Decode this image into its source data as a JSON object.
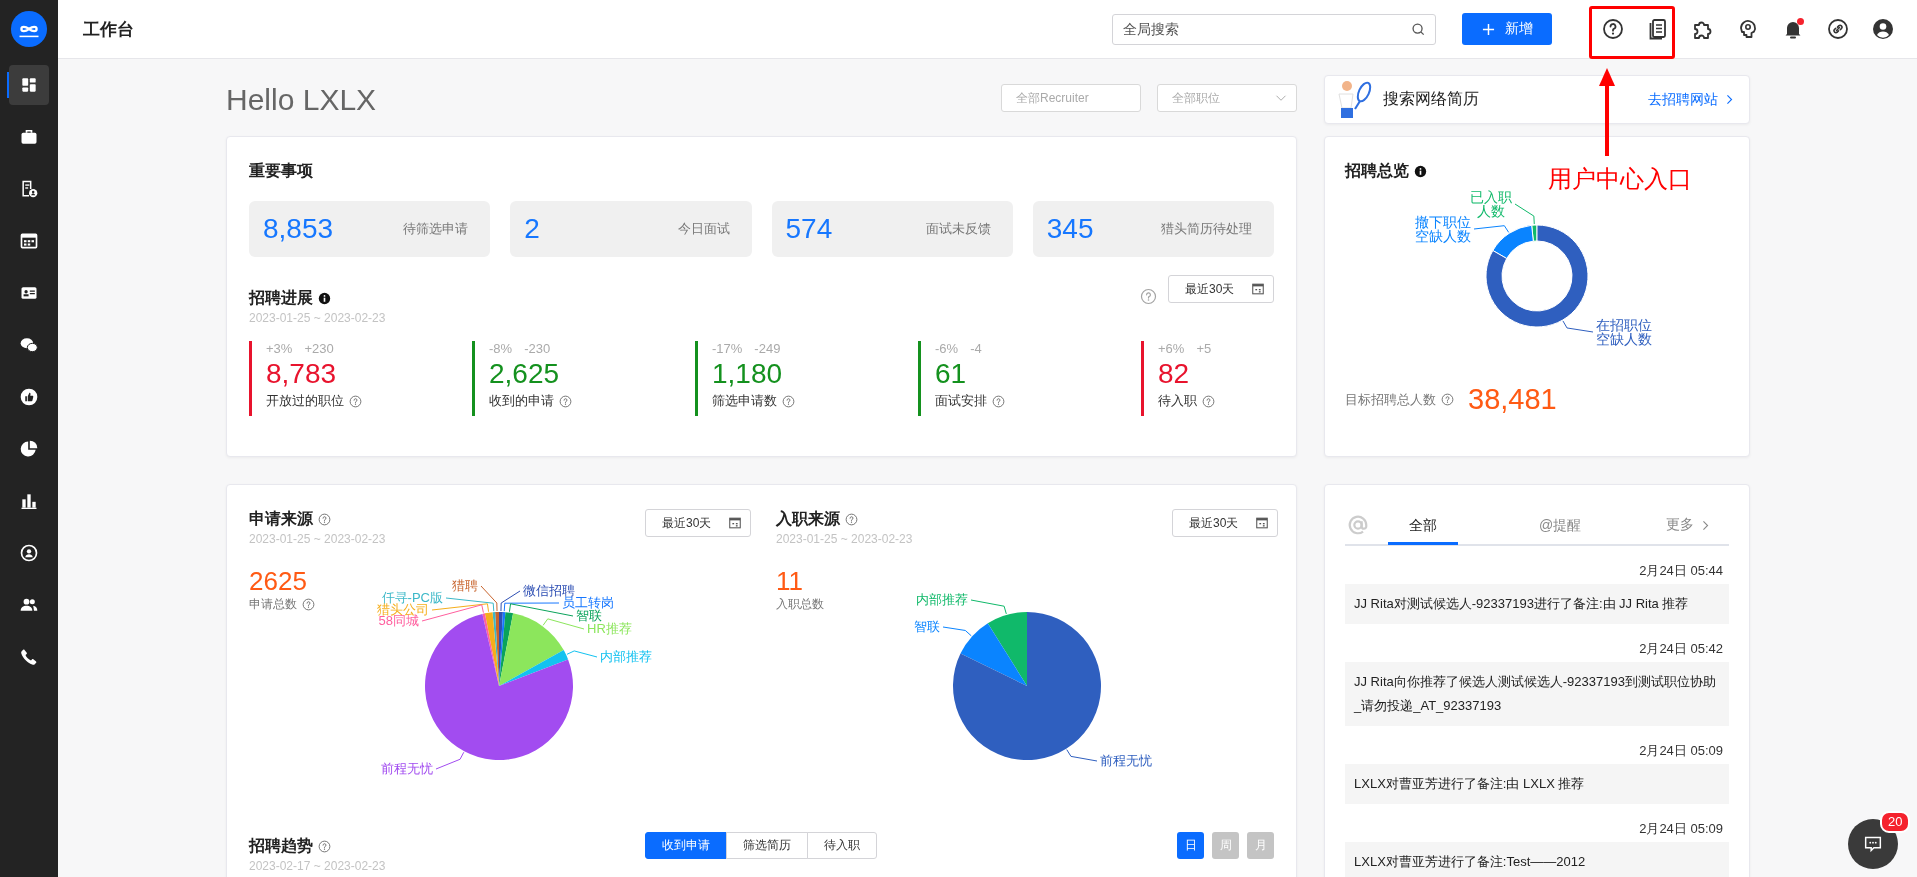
{
  "sidebar": {
    "items": [
      {
        "kind": "dashboard",
        "selected": true
      },
      {
        "kind": "briefcase",
        "selected": false
      },
      {
        "kind": "resume",
        "selected": false
      },
      {
        "kind": "calendar",
        "selected": false
      },
      {
        "kind": "idcard",
        "selected": false
      },
      {
        "kind": "chat",
        "selected": false
      },
      {
        "kind": "thumb",
        "selected": false
      },
      {
        "kind": "pie",
        "selected": false
      },
      {
        "kind": "bars",
        "selected": false
      },
      {
        "kind": "person",
        "selected": false
      },
      {
        "kind": "people",
        "selected": false
      },
      {
        "kind": "phone",
        "selected": false
      }
    ]
  },
  "header": {
    "title": "工作台",
    "search": {
      "placeholder": "全局搜索"
    },
    "new_button": "新增"
  },
  "toolbar": [
    {
      "kind": "help",
      "badge": false
    },
    {
      "kind": "docs",
      "badge": false
    },
    {
      "kind": "puzzle",
      "badge": false
    },
    {
      "kind": "head",
      "badge": false
    },
    {
      "kind": "bell",
      "badge": true
    },
    {
      "kind": "link",
      "badge": false
    },
    {
      "kind": "user",
      "badge": false
    }
  ],
  "greeting": "Hello LXLX",
  "filters": [
    {
      "kind": "input",
      "placeholder": "全部Recruiter"
    },
    {
      "kind": "select",
      "placeholder": "全部职位"
    }
  ],
  "banner": {
    "title": "搜索网络简历",
    "link": "去招聘网站"
  },
  "important": {
    "title": "重要事项",
    "tiles": [
      {
        "count": "8,853",
        "caption": "待筛选申请"
      },
      {
        "count": "2",
        "caption": "今日面试"
      },
      {
        "count": "574",
        "caption": "面试未反馈"
      },
      {
        "count": "345",
        "caption": "猎头简历待处理"
      }
    ]
  },
  "progress": {
    "title": "招聘进展",
    "date_range": "2023-01-25 ~ 2023-02-23",
    "period": "最近30天",
    "metrics": [
      {
        "pct": "+3%",
        "delta": "+230",
        "value": "8,783",
        "label": "开放过的职位",
        "color": "#e8132d"
      },
      {
        "pct": "-8%",
        "delta": "-230",
        "value": "2,625",
        "label": "收到的申请",
        "color": "#14911e"
      },
      {
        "pct": "-17%",
        "delta": "-249",
        "value": "1,180",
        "label": "筛选申请数",
        "color": "#14911e"
      },
      {
        "pct": "-6%",
        "delta": "-4",
        "value": "61",
        "label": "面试安排",
        "color": "#14911e"
      },
      {
        "pct": "+6%",
        "delta": "+5",
        "value": "82",
        "label": "待入职",
        "color": "#e8132d"
      }
    ]
  },
  "sources": {
    "title": "申请来源",
    "date_range": "2023-01-25 ~ 2023-02-23",
    "period": "最近30天",
    "total": "2625",
    "total_label": "申请总数",
    "slices": [
      {
        "label": "猎聘",
        "color": "#c8642d"
      },
      {
        "label": "微信招聘",
        "color": "#2e4fb3"
      },
      {
        "label": "仟寻-PC版",
        "color": "#3cb8c8"
      },
      {
        "label": "员工转岗",
        "color": "#1677ff"
      },
      {
        "label": "猎头公司",
        "color": "#f5ae1b"
      },
      {
        "label": "58同城",
        "color": "#ff5f9e"
      },
      {
        "label": "智联",
        "color": "#0aa35b"
      },
      {
        "label": "HR推荐",
        "color": "#8ce65c"
      },
      {
        "label": "内部推荐",
        "color": "#13c2f0"
      },
      {
        "label": "前程无忧",
        "color": "#a24cf0"
      }
    ]
  },
  "hires": {
    "title": "入职来源",
    "date_range": "2023-01-25 ~ 2023-02-23",
    "period": "最近30天",
    "total": "11",
    "total_label": "入职总数",
    "slices": [
      {
        "label": "内部推荐",
        "color": "#10b96a"
      },
      {
        "label": "智联",
        "color": "#0a84ff"
      },
      {
        "label": "前程无忧",
        "color": "#2f5fbf"
      }
    ]
  },
  "trend": {
    "title": "招聘趋势",
    "date_range": "2023-02-17 ~ 2023-02-23",
    "tabs": [
      {
        "label": "收到申请",
        "selected": true
      },
      {
        "label": "筛选简历",
        "selected": false
      },
      {
        "label": "待入职",
        "selected": false
      }
    ],
    "granularity": [
      {
        "label": "日",
        "selected": true
      },
      {
        "label": "周",
        "selected": false
      },
      {
        "label": "月",
        "selected": false
      }
    ]
  },
  "overview": {
    "title": "招聘总览",
    "segments": [
      {
        "lines": [
          "已入职",
          "人数"
        ],
        "color": "#10b96a"
      },
      {
        "lines": [
          "撤下职位",
          "空缺人数"
        ],
        "color": "#0a84ff"
      },
      {
        "lines": [
          "在招职位",
          "空缺人数"
        ],
        "color": "#2f5fbf"
      }
    ],
    "target_label": "目标招聘总人数",
    "target_value": "38,481"
  },
  "feed": {
    "tabs": [
      {
        "label": "全部",
        "selected": true
      },
      {
        "label": "@提醒",
        "selected": false
      }
    ],
    "more": "更多",
    "items": [
      {
        "time": "2月24日 05:44",
        "text": "JJ Rita对测试候选人-92337193进行了备注:由 JJ Rita 推荐"
      },
      {
        "time": "2月24日 05:42",
        "text": "JJ Rita向你推荐了候选人测试候选人-92337193到测试职位协助_请勿投递_AT_92337193"
      },
      {
        "time": "2月24日 05:09",
        "text": "LXLX对曹亚芳进行了备注:由 LXLX 推荐"
      },
      {
        "time": "2月24日 05:09",
        "text": "LXLX对曹亚芳进行了备注:Test——2012"
      }
    ]
  },
  "chat": {
    "badge": "20"
  },
  "annotation": {
    "text": "用户中心入口"
  }
}
